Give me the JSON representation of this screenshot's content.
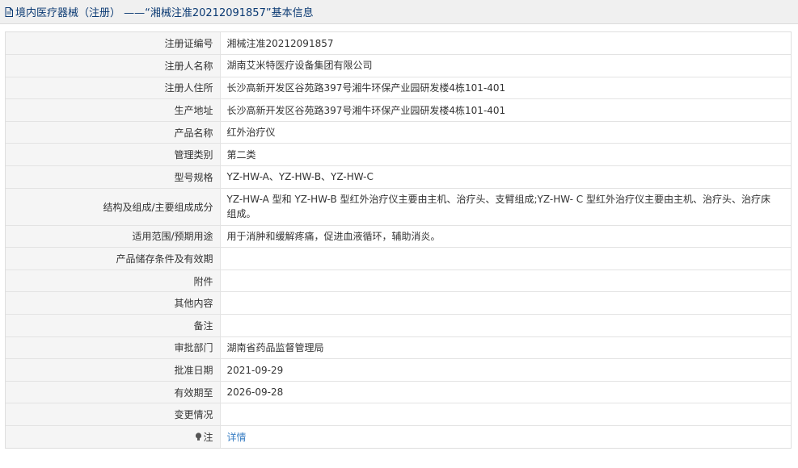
{
  "header": {
    "title": "境内医疗器械（注册） ——“湘械注准20212091857”基本信息"
  },
  "rows": [
    {
      "label": "注册证编号",
      "value": "湘械注准20212091857"
    },
    {
      "label": "注册人名称",
      "value": "湖南艾米特医疗设备集团有限公司"
    },
    {
      "label": "注册人住所",
      "value": "长沙高新开发区谷苑路397号湘牛环保产业园研发楼4栋101-401"
    },
    {
      "label": "生产地址",
      "value": "长沙高新开发区谷苑路397号湘牛环保产业园研发楼4栋101-401"
    },
    {
      "label": "产品名称",
      "value": "红外治疗仪"
    },
    {
      "label": "管理类别",
      "value": "第二类"
    },
    {
      "label": "型号规格",
      "value": "YZ-HW-A、YZ-HW-B、YZ-HW-C"
    },
    {
      "label": "结构及组成/主要组成成分",
      "value": "YZ-HW-A 型和 YZ-HW-B 型红外治疗仪主要由主机、治疗头、支臂组成;YZ-HW- C 型红外治疗仪主要由主机、治疗头、治疗床组成。"
    },
    {
      "label": "适用范围/预期用途",
      "value": "用于消肿和缓解疼痛，促进血液循环，辅助消炎。"
    },
    {
      "label": "产品储存条件及有效期",
      "value": ""
    },
    {
      "label": "附件",
      "value": ""
    },
    {
      "label": "其他内容",
      "value": ""
    },
    {
      "label": "备注",
      "value": ""
    },
    {
      "label": "审批部门",
      "value": "湖南省药品监督管理局"
    },
    {
      "label": "批准日期",
      "value": "2021-09-29"
    },
    {
      "label": "有效期至",
      "value": "2026-09-28"
    },
    {
      "label": "变更情况",
      "value": ""
    }
  ],
  "note": {
    "label": "注",
    "link": "详情"
  },
  "colors": {
    "header_text": "#0b3a73",
    "link": "#3b7fc4",
    "label_bg": "#f5f5f5"
  },
  "icons": {
    "header": "document-icon",
    "note": "lightbulb-icon"
  }
}
